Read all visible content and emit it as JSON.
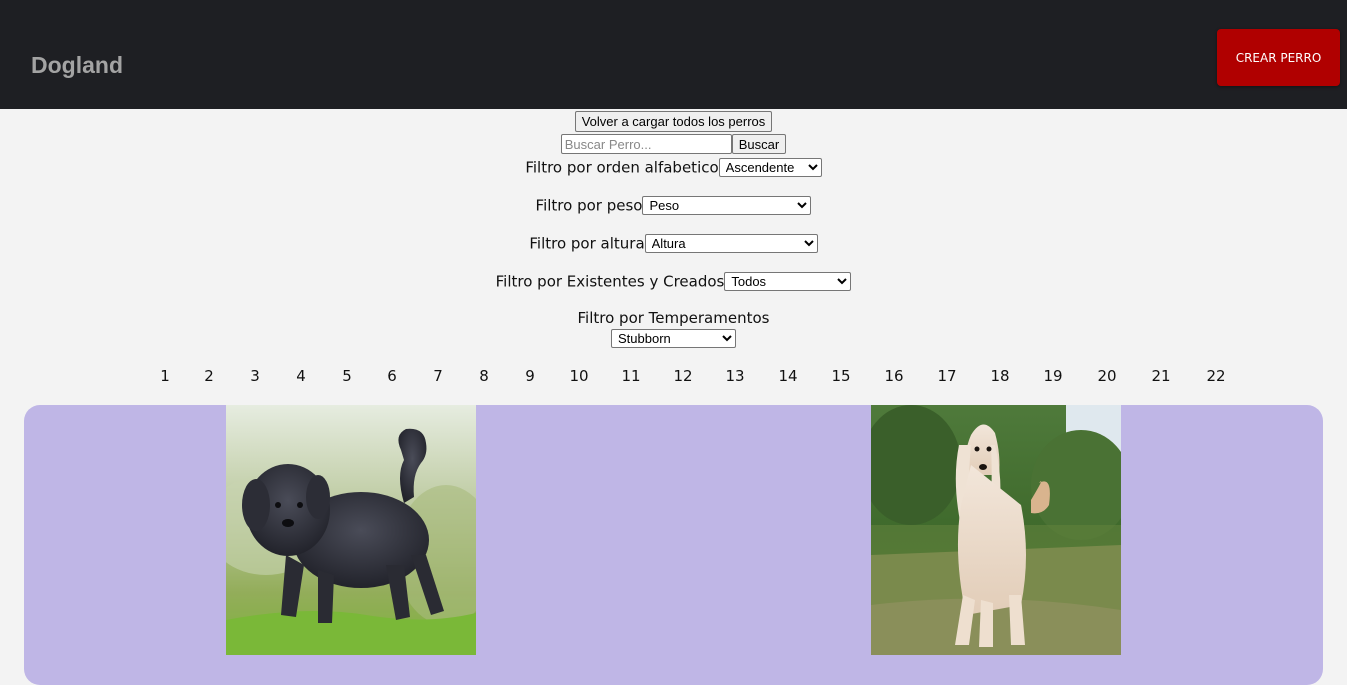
{
  "navbar": {
    "brand": "Dogland",
    "create_label": "CREAR PERRO"
  },
  "controls": {
    "reload_label": "Volver a cargar todos los perros",
    "search_placeholder": "Buscar Perro...",
    "search_label": "Buscar"
  },
  "filters": {
    "alpha": {
      "label": "Filtro por orden alfabetico",
      "selected": "Ascendente"
    },
    "weight": {
      "label": "Filtro por peso",
      "selected": "Peso"
    },
    "height": {
      "label": "Filtro por altura",
      "selected": "Altura"
    },
    "origin": {
      "label": "Filtro por Existentes y Creados",
      "selected": "Todos"
    },
    "temperament": {
      "label": "Filtro por Temperamentos",
      "selected": "Stubborn"
    }
  },
  "pagination": [
    "1",
    "2",
    "3",
    "4",
    "5",
    "6",
    "7",
    "8",
    "9",
    "10",
    "11",
    "12",
    "13",
    "14",
    "15",
    "16",
    "17",
    "18",
    "19",
    "20",
    "21",
    "22"
  ],
  "cards": [
    {
      "image": "black shaggy dog on grass"
    },
    {
      "image": "afghan hound in a field"
    }
  ]
}
